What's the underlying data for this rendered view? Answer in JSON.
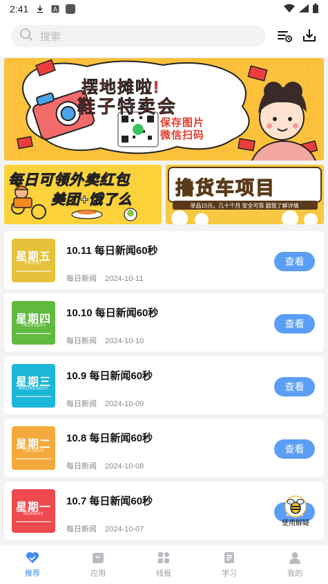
{
  "status_bar": {
    "time": "2:41"
  },
  "search": {
    "placeholder": "搜索"
  },
  "banner": {
    "headline_1": "摆地摊啦!",
    "headline_2": "鞋子特卖会",
    "caption_1": "保存图片",
    "caption_2": "微信扫码"
  },
  "promos": {
    "left": {
      "line_1": "每日可领外卖红包",
      "line_2": "美团+饿了么"
    },
    "right": {
      "title": "撸货车项目",
      "subtitle": "单品15元，几十个月 安全可靠 戳我了解详情"
    }
  },
  "news": [
    {
      "weekday_cn": "星期五",
      "weekday_en": "FRIDAY",
      "color": "#e6c13a",
      "title": "10.11 每日新闻60秒",
      "source": "每日新闻",
      "date": "2024-10-11",
      "button": "查看"
    },
    {
      "weekday_cn": "星期四",
      "weekday_en": "THURSDAY",
      "color": "#5fba3e",
      "title": "10.10 每日新闻60秒",
      "source": "每日新闻",
      "date": "2024-10-10",
      "button": "查看"
    },
    {
      "weekday_cn": "星期三",
      "weekday_en": "WEDNESDAY",
      "color": "#1cb6d9",
      "title": "10.9 每日新闻60秒",
      "source": "每日新闻",
      "date": "2024-10-09",
      "button": "查看"
    },
    {
      "weekday_cn": "星期二",
      "weekday_en": "TUESDAY",
      "color": "#f4a93c",
      "title": "10.8 每日新闻60秒",
      "source": "每日新闻",
      "date": "2024-10-08",
      "button": "查看"
    },
    {
      "weekday_cn": "星期一",
      "weekday_en": "MONDAY",
      "color": "#ee4a4e",
      "title": "10.7 每日新闻60秒",
      "source": "每日新闻",
      "date": "2024-10-07",
      "button": "查看"
    }
  ],
  "helper": {
    "label": "使用解疑"
  },
  "tabs": [
    {
      "label": "推荐",
      "icon": "heart-icon",
      "active": true
    },
    {
      "label": "应用",
      "icon": "app-icon",
      "active": false
    },
    {
      "label": "线报",
      "icon": "grid-icon",
      "active": false
    },
    {
      "label": "学习",
      "icon": "book-icon",
      "active": false
    },
    {
      "label": "我的",
      "icon": "user-icon",
      "active": false
    }
  ],
  "colors": {
    "accent": "#3d8cf3",
    "button": "#5b9ef6"
  }
}
